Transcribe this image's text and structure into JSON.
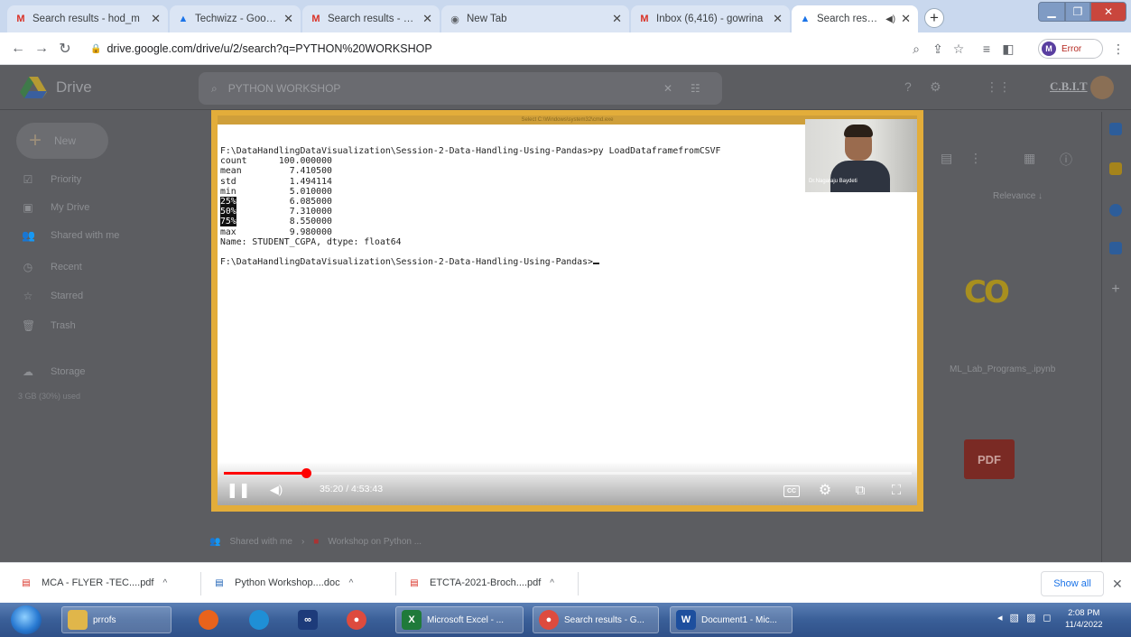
{
  "browser": {
    "tabs": [
      {
        "title": "Search results - hod_m",
        "favicon": "gmail-icon"
      },
      {
        "title": "Techwizz - Google Driv",
        "favicon": "drive-icon"
      },
      {
        "title": "Search results - hod_m",
        "favicon": "gmail-icon"
      },
      {
        "title": "New Tab",
        "favicon": "chrome-icon"
      },
      {
        "title": "Inbox (6,416) - gowrina",
        "favicon": "gmail-icon"
      },
      {
        "title": "Search results - Go",
        "favicon": "drive-icon"
      }
    ],
    "url": "drive.google.com/drive/u/2/search?q=PYTHON%20WORKSHOP",
    "profile_initial": "M",
    "profile_status": "Error"
  },
  "drive": {
    "app_name": "Drive",
    "search_value": "PYTHON WORKSHOP",
    "new_label": "New",
    "sidebar": [
      {
        "label": "Priority",
        "icon": "check-icon"
      },
      {
        "label": "My Drive",
        "icon": "my-drive-icon"
      },
      {
        "label": "Shared with me",
        "icon": "people-icon"
      },
      {
        "label": "Recent",
        "icon": "clock-icon"
      },
      {
        "label": "Starred",
        "icon": "star-icon"
      },
      {
        "label": "Trash",
        "icon": "trash-icon"
      }
    ],
    "storage_label": "Storage",
    "storage_used": "3 GB (30%) used",
    "sort_label": "Relevance",
    "file_label": "ML_Lab_Programs_.ipynb",
    "breadcrumb": [
      "Shared with me",
      "Workshop on Python ..."
    ],
    "org_logo_text": "C.B.I.T"
  },
  "video": {
    "cmd_title": "Select C:\\Windows\\system32\\cmd.exe",
    "console_lines": [
      {
        "label": "",
        "value": "F:\\DataHandlingDataVisualization\\Session-2-Data-Handling-Using-Pandas>py LoadDataframefromCSVF"
      },
      {
        "label": "count",
        "value": "100.000000"
      },
      {
        "label": "mean",
        "value": "7.410500"
      },
      {
        "label": "std",
        "value": "1.494114"
      },
      {
        "label": "min",
        "value": "5.010000"
      },
      {
        "label": "25%",
        "value": "6.085000"
      },
      {
        "label": "50%",
        "value": "7.310000"
      },
      {
        "label": "75%",
        "value": "8.550000"
      },
      {
        "label": "max",
        "value": "9.980000"
      }
    ],
    "name_line": "Name: STUDENT_CGPA, dtype: float64",
    "prompt_line": "F:\\DataHandlingDataVisualization\\Session-2-Data-Handling-Using-Pandas>",
    "presenter": "Dr.Nagaraju Baydeti",
    "current_time": "35:20",
    "duration": "4:53:43",
    "progress_fraction": 0.12
  },
  "downloads": [
    {
      "name": "MCA - FLYER -TEC....pdf",
      "type": "pdf"
    },
    {
      "name": "Python Workshop....doc",
      "type": "doc"
    },
    {
      "name": "ETCTA-2021-Broch....pdf",
      "type": "pdf"
    }
  ],
  "show_all_label": "Show all",
  "taskbar": {
    "folder_label": "prrofs",
    "excel_label": "Microsoft Excel - ...",
    "chrome_label": "Search results - G...",
    "word_label": "Document1 - Mic...",
    "time": "2:08 PM",
    "date": "11/4/2022"
  }
}
